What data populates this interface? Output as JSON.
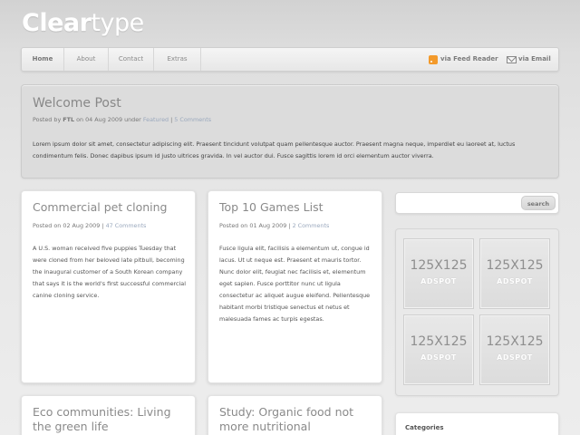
{
  "site": {
    "logo_bold": "Clear",
    "logo_light": "type"
  },
  "nav": {
    "items": [
      "Home",
      "About",
      "Contact",
      "Extras"
    ],
    "feed_label": "via Feed Reader",
    "email_label": "via Email"
  },
  "welcome": {
    "title": "Welcome Post",
    "meta_prefix": "Posted by",
    "author": "FTL",
    "date_text": "on 04 Aug 2009 under",
    "category": "Featured",
    "comments": "5 Comments",
    "body": "Lorem ipsum dolor sit amet, consectetur adipiscing elit. Praesent tincidunt volutpat quam pellentesque auctor. Praesent magna neque, imperdiet eu laoreet at, luctus condimentum felis. Donec dapibus ipsum id justo ultrices gravida. In vel auctor dui. Fusce sagittis lorem id orci elementum auctor viverra."
  },
  "posts": [
    {
      "title": "Commercial pet cloning",
      "meta": "Posted on 02 Aug 2009 |",
      "comments": "47 Comments",
      "body": "A U.S. woman received five puppies Tuesday that were cloned from her beloved late pitbull, becoming the inaugural customer of a South Korean company that says it is the world's first successful commercial canine cloning service."
    },
    {
      "title": "Top 10 Games List",
      "meta": "Posted on 01 Aug 2009 |",
      "comments": "2 Comments",
      "body": "Fusce ligula elit, facilisis a elementum ut, congue id lacus. Ut ut neque est. Praesent et mauris tortor. Nunc dolor elit, feugiat nec facilisis et, elementum eget sapien. Fusce porttitor nunc ut ligula consectetur ac aliquet augue eleifend. Pellentesque habitant morbi tristique senectus et netus et malesuada fames ac turpis egestas."
    },
    {
      "title": "Eco communities: Living the green life"
    },
    {
      "title": "Study: Organic food not more nutritional"
    }
  ],
  "sidebar": {
    "search_button": "search",
    "ad_size": "125X125",
    "ad_label": "ADSPOT",
    "categories_heading": "Categories"
  }
}
